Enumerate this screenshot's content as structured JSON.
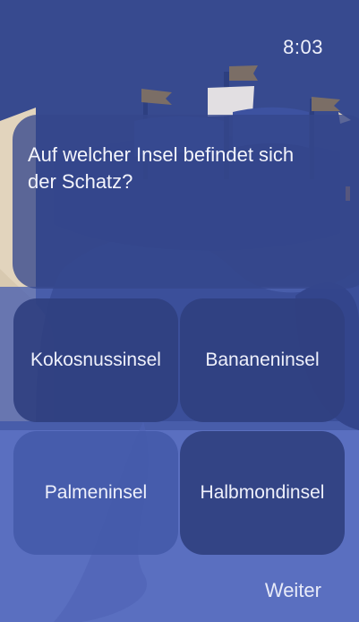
{
  "status_bar": {
    "time": "8:03"
  },
  "quiz": {
    "question": "Auf welcher Insel befindet sich der Schatz?",
    "answers": [
      "Kokosnussinsel",
      "Bananeninsel",
      "Palmeninsel",
      "Halbmondinsel"
    ],
    "next_label": "Weiter"
  },
  "colors": {
    "background_top": "#374a8f",
    "background_bottom": "#5a6fc0",
    "sand": "#e2d4bd"
  }
}
